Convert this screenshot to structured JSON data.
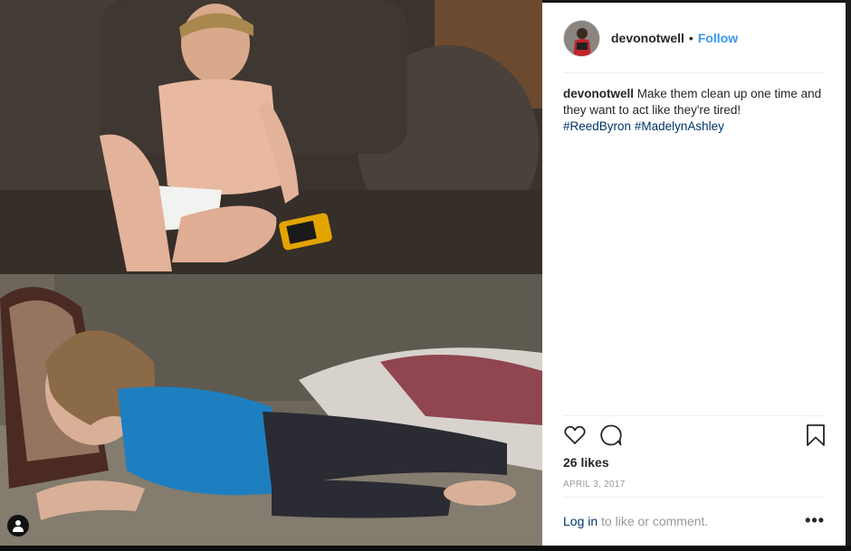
{
  "post": {
    "username": "devonotwell",
    "separator": "•",
    "follow_label": "Follow",
    "caption_user": "devonotwell",
    "caption_text": "Make them clean up one time and they want to act like they're tired!",
    "hashtags": [
      "#ReedByron",
      "#MadelynAshley"
    ],
    "likes": "26 likes",
    "date": "APRIL 3, 2017",
    "login_label": "Log in",
    "login_suffix": " to like or comment.",
    "more_label": "•••"
  },
  "icons": {
    "heart": "heart-icon",
    "comment": "comment-icon",
    "bookmark": "bookmark-icon",
    "user_tag": "user-tag-icon"
  },
  "colors": {
    "link_blue": "#3897f0",
    "hashtag": "#003569",
    "text": "#262626",
    "muted": "#999999"
  }
}
